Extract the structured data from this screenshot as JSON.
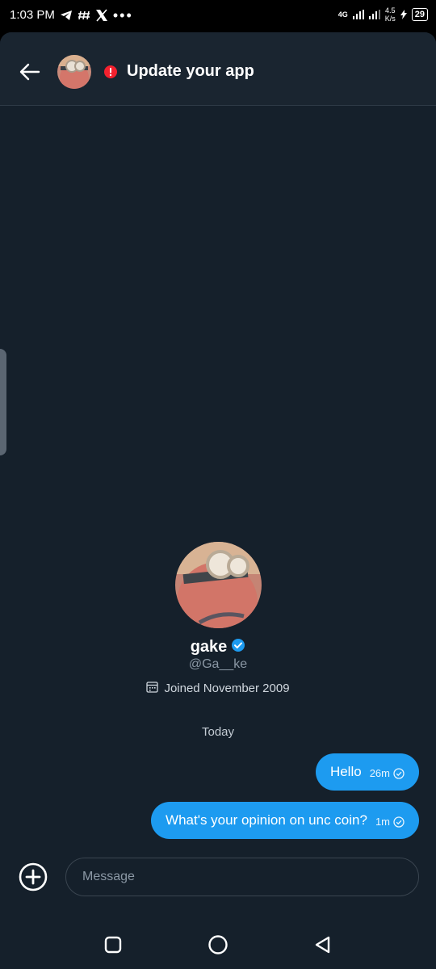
{
  "status_bar": {
    "time": "1:03 PM",
    "network": "4G",
    "speed_value": "4.5",
    "speed_unit": "K/s",
    "battery": "29"
  },
  "header": {
    "title": "Update your app"
  },
  "profile": {
    "name": "gake",
    "handle": "@Ga__ke",
    "joined": "Joined November 2009"
  },
  "conversation": {
    "day_label": "Today",
    "messages": [
      {
        "text": "Hello",
        "time": "26m"
      },
      {
        "text": "What's your opinion on unc coin?",
        "time": "1m"
      }
    ]
  },
  "composer": {
    "placeholder": "Message"
  },
  "colors": {
    "background": "#15202b",
    "bubble": "#1d9bf0",
    "verified": "#1d9bf0",
    "alert": "#f4212e"
  }
}
